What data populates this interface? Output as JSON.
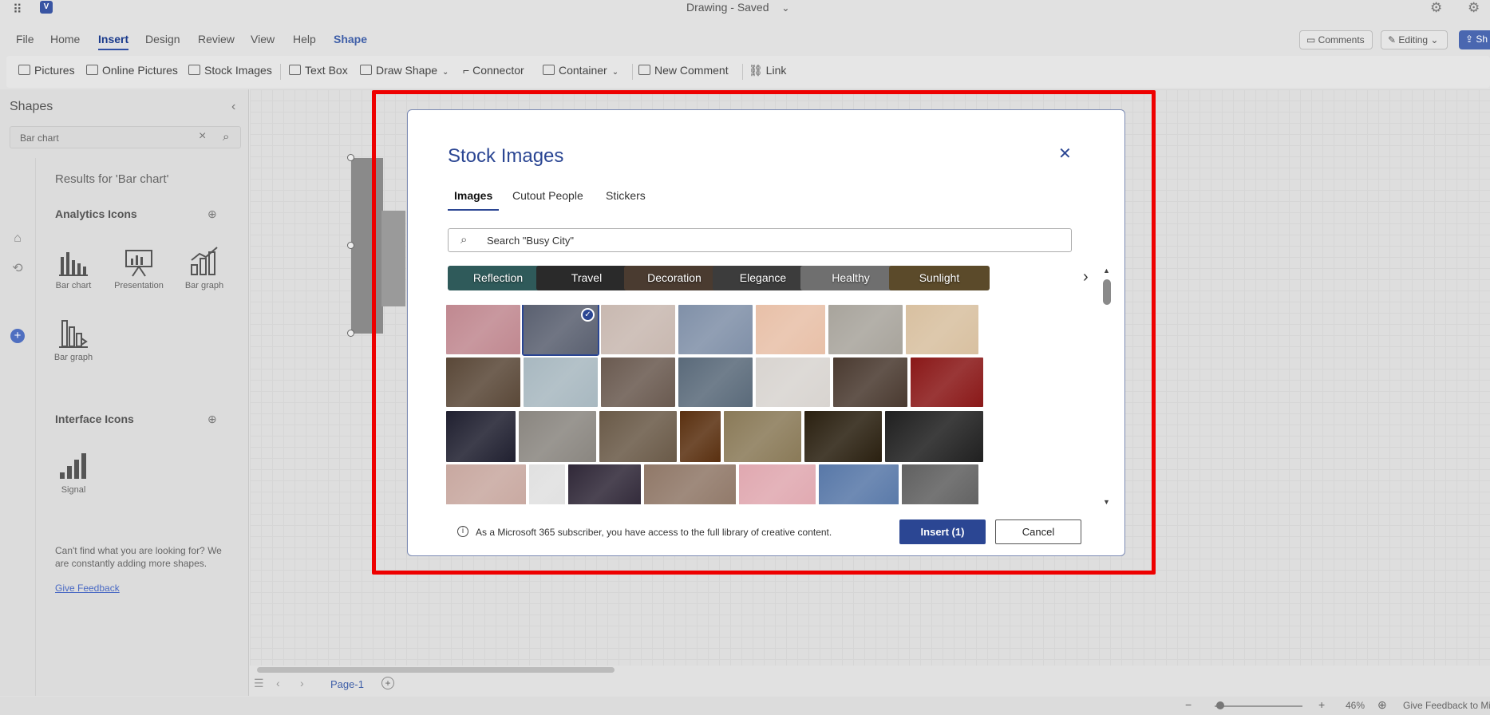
{
  "titlebar": {
    "doc_name": "Drawing",
    "separator": "-",
    "save_status": "Saved"
  },
  "menu": {
    "tabs": [
      "File",
      "Home",
      "Insert",
      "Design",
      "Review",
      "View",
      "Help",
      "Shape"
    ],
    "comments": "Comments",
    "editing": "Editing",
    "share": "Sh"
  },
  "ribbon": {
    "pictures": "Pictures",
    "online_pictures": "Online Pictures",
    "stock_images": "Stock Images",
    "text_box": "Text Box",
    "draw_shape": "Draw Shape",
    "connector": "Connector",
    "container": "Container",
    "new_comment": "New Comment",
    "link": "Link"
  },
  "shapes_panel": {
    "title": "Shapes",
    "search_value": "Bar chart",
    "results_label": "Results for 'Bar chart'",
    "analytics_title": "Analytics Icons",
    "analytics_items": [
      "Bar chart",
      "Presentation",
      "Bar graph",
      "Bar graph"
    ],
    "interface_title": "Interface Icons",
    "interface_items": [
      "Signal"
    ],
    "cant_find": "Can't find what you are looking for? We are constantly adding more shapes.",
    "feedback_link": "Give Feedback"
  },
  "status": {
    "page_tab": "Page-1",
    "zoom": "46%",
    "give_feedback": "Give Feedback to Mi"
  },
  "dialog": {
    "title": "Stock Images",
    "tabs": [
      "Images",
      "Cutout People",
      "Stickers"
    ],
    "search_value": "Search \"Busy City\"",
    "chips": [
      {
        "label": "Reflection",
        "color": "#2f5a5a"
      },
      {
        "label": "Travel",
        "color": "#2a2a2a"
      },
      {
        "label": "Decoration",
        "color": "#4a3b30"
      },
      {
        "label": "Elegance",
        "color": "#3c3c3c"
      },
      {
        "label": "Healthy",
        "color": "#6f6f6f"
      },
      {
        "label": "Sunlight",
        "color": "#5b4a2a"
      }
    ],
    "image_rows": [
      [
        "#c08890",
        "#5a6070",
        "#c8b8b0",
        "#8090a8",
        "#e8c0a8",
        "#a8a49c",
        "#d8c0a0"
      ],
      [
        "#5a4838",
        "#a8b8c0",
        "#6a5a50",
        "#5a6a7a",
        "#d8d4d0",
        "#4a3a30",
        "#8a1818"
      ],
      [
        "#202030",
        "#8a8680",
        "#6a5a48",
        "#5a3010",
        "#8a7a58",
        "#2a2010",
        "#202020"
      ],
      [
        "#c8a8a0",
        "#e0e0e0",
        "#302838",
        "#907868",
        "#e0a8b0",
        "#5878a8",
        "#606060"
      ]
    ],
    "selected_count_label": "Insert (1)",
    "info": "As a Microsoft 365 subscriber, you have access to the full library of creative content.",
    "insert_label": "Insert (1)",
    "cancel_label": "Cancel"
  }
}
